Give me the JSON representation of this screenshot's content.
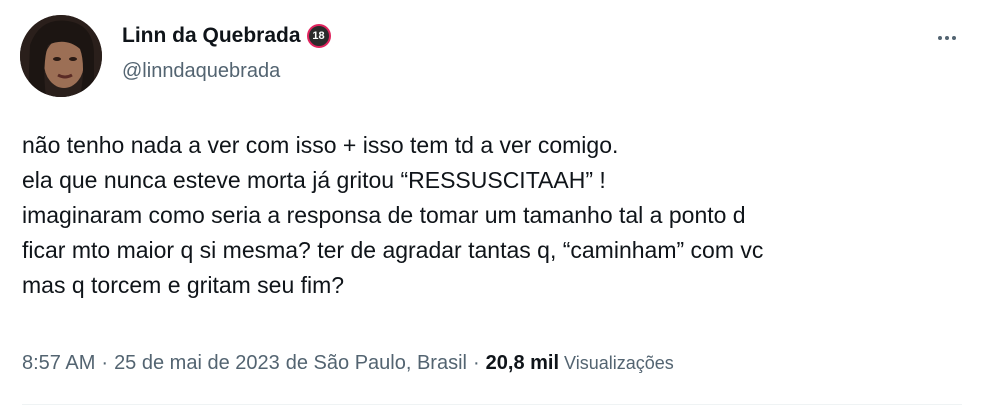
{
  "author": {
    "display_name": "Linn da Quebrada",
    "badge": "18",
    "handle": "@linndaquebrada"
  },
  "tweet": {
    "lines": [
      "não tenho nada a ver com isso + isso tem td a ver comigo.",
      "ela que nunca esteve morta já gritou “RESSUSCITAAH” !",
      "imaginaram como seria a responsa de tomar um tamanho tal a ponto d",
      "ficar mto maior q si mesma? ter de agradar tantas q, “caminham” com vc",
      "mas q torcem e gritam seu fim?"
    ]
  },
  "meta": {
    "time": "8:57 AM",
    "separator": "·",
    "date": "25 de mai de 2023",
    "location": "de São Paulo, Brasil",
    "views_count": "20,8 mil",
    "views_label": "Visualizações"
  },
  "icons": {
    "more": "more-horizontal-icon",
    "badge": "age-18-badge-icon"
  },
  "colors": {
    "text_primary": "#0f1419",
    "text_secondary": "#536471",
    "badge_ring": "#e0245e"
  }
}
